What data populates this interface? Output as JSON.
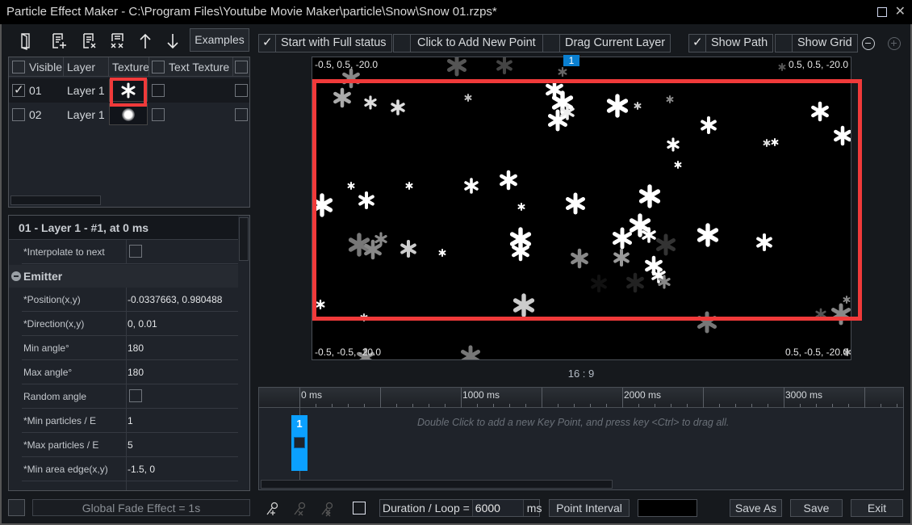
{
  "window": {
    "title": "Particle Effect Maker - C:\\Program Files\\Youtube Movie Maker\\particle\\Snow\\Snow 01.rzps*",
    "maximize_icon": "maximize-icon",
    "close_icon": "close-icon"
  },
  "toolbar": {
    "icons": [
      "open-file-icon",
      "add-layer-icon",
      "delete-layer-icon",
      "delete-all-layers-icon",
      "move-up-icon",
      "move-down-icon"
    ],
    "examples_label": "Examples"
  },
  "layer_table": {
    "headers": {
      "visible": "Visible",
      "layer": "Layer",
      "texture": "Texture",
      "text_texture": "Text Texture"
    },
    "rows": [
      {
        "id": "01",
        "layer": "Layer 1",
        "visible": true,
        "texture": "snowflake",
        "text_texture": false,
        "extra": false,
        "selected": true
      },
      {
        "id": "02",
        "layer": "Layer 1",
        "visible": false,
        "texture": "soft-dot",
        "text_texture": false,
        "extra": false,
        "selected": false
      }
    ]
  },
  "properties": {
    "title": "01 - Layer 1 - #1, at 0 ms",
    "interpolate": {
      "label": "*Interpolate to next",
      "checked": false
    },
    "group": "Emitter",
    "rows": [
      {
        "label": "*Position(x,y)",
        "value": "-0.0337663, 0.980488"
      },
      {
        "label": "*Direction(x,y)",
        "value": "0, 0.01"
      },
      {
        "label": "Min angle°",
        "value": "180"
      },
      {
        "label": "Max angle°",
        "value": "180"
      },
      {
        "label": "Random angle",
        "checkbox": true,
        "checked": false
      },
      {
        "label": "*Min particles / E",
        "value": "1"
      },
      {
        "label": "*Max particles / E",
        "value": "5"
      },
      {
        "label": "*Min area edge(x,y)",
        "value": "-1.5, 0"
      }
    ]
  },
  "global_fade": {
    "label": "Global Fade Effect = 1s",
    "checked": false
  },
  "options": {
    "start_full": {
      "label": "Start with Full status",
      "checked": true
    },
    "click_add": {
      "label": "Click to Add New Point",
      "checked": false
    },
    "drag_layer": {
      "label": "Drag Current Layer",
      "checked": false
    },
    "show_path": {
      "label": "Show Path",
      "checked": true
    },
    "show_grid": {
      "label": "Show Grid",
      "checked": false
    },
    "zoom_out_icon": "zoom-out-icon",
    "zoom_in_icon": "zoom-in-icon"
  },
  "viewport": {
    "top_left": "-0.5, 0.5, -20.0",
    "top_right": "0.5, 0.5, -20.0",
    "bottom_left": "-0.5, -0.5, -20.0",
    "bottom_right": "0.5, -0.5, -20.0",
    "key_point_marker": "1",
    "aspect_ratio": "16 : 9"
  },
  "timeline": {
    "tick_labels": [
      "0 ms",
      "1000 ms",
      "2000 ms",
      "3000 ms"
    ],
    "key_points": [
      {
        "label": "1",
        "time_ms": 0
      }
    ],
    "hint": "Double Click to add a new Key Point, and press key <Ctrl> to drag all."
  },
  "bottom_bar": {
    "icons": [
      "add-point-icon",
      "remove-point-icon",
      "remove-all-points-icon"
    ],
    "loop_checked": false,
    "duration_label": "Duration / Loop =",
    "duration_value": "6000",
    "duration_unit": "ms",
    "point_interval_label": "Point Interval",
    "save_as_label": "Save As",
    "save_label": "Save",
    "exit_label": "Exit"
  },
  "colors": {
    "accent_blue": "#0ba0ff",
    "highlight_red": "#f03a3a",
    "background": "#16191d",
    "panel": "#1f232a"
  }
}
